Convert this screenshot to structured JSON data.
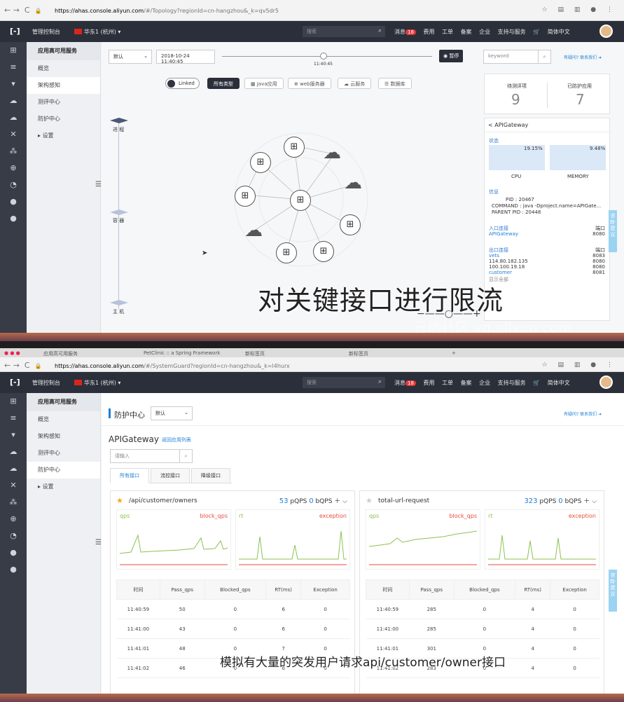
{
  "top": {
    "url_host": "https://ahas.console.aliyun.com",
    "url_path": "/#/Topology?regionId=cn-hangzhou&_k=qv5dr5",
    "console": "管理控制台",
    "region": "华东1 (杭州)",
    "search_placeholder": "搜索",
    "msg_label": "消息",
    "msg_count": "18",
    "menu": [
      "费用",
      "工单",
      "备案",
      "企业",
      "支持与服务"
    ],
    "lang": "简体中文",
    "sidebar_title": "应用高可用服务",
    "sidebar_items": [
      "概览",
      "架构感知",
      "测评中心",
      "防护中心",
      "设置"
    ],
    "env_select": "默认",
    "datetime": "2018-10-24 11:40:45",
    "slider_time": "11:40:45",
    "pause_label": "暂停",
    "keyword_placeholder": "keyword",
    "help_link": "有疑问? 联系我们",
    "linked_label": "Linked",
    "filters": [
      "所有类型",
      "Java应用",
      "web服务器",
      "云服务",
      "数据库"
    ],
    "layers": [
      "进 程",
      "容 器",
      "主 机"
    ],
    "score_labels": [
      "待测评项",
      "已防护应用"
    ],
    "score_values": [
      "9",
      "7"
    ],
    "detail_title": "APIGateway",
    "status_label": "状态",
    "cpu_pct": "19.15%",
    "mem_pct": "9.48%",
    "cpu_label": "CPU",
    "mem_label": "MEMORY",
    "info_label": "信息",
    "pid": "PID : 20467",
    "command": "COMMAND : java -Dproject.name=APIGate...",
    "ppid": "PARENT PID : 20448",
    "inbound_label": "入口连接",
    "port_label": "端口",
    "inbound_name": "APIGateway",
    "inbound_port": "8080",
    "outbound_label": "出口连接",
    "outbound_names": [
      "vets",
      "114.80.182.135",
      "100.100.19.18",
      "customer"
    ],
    "outbound_ports": [
      "8083",
      "8080",
      "8080",
      "8081"
    ],
    "show_all": "显示全部",
    "subtitle": "对关键接口进行限流",
    "watermark": "云栖社区 yq.aliyun.com",
    "feedback": "咨询·建议"
  },
  "bottom": {
    "url_host": "https://ahas.console.aliyun.com",
    "url_path": "/#/SystemGuard?regionId=cn-hangzhou&_k=l4hurx",
    "tabs": [
      "应用高可用服务",
      "PetClinic :: a Spring Framework",
      "新标签页",
      "新标签页"
    ],
    "page_title": "防护中心",
    "env_select": "默认",
    "app_name": "APIGateway",
    "back_link": "返回应用列表",
    "search_placeholder": "请输入",
    "iface_tabs": [
      "所有接口",
      "流控接口",
      "降级接口"
    ],
    "cards": [
      {
        "name": "/api/customer/owners",
        "pqps": "53",
        "bqps": "0",
        "starred": true,
        "rows": [
          [
            "11:40:59",
            "50",
            "0",
            "6",
            "0"
          ],
          [
            "11:41:00",
            "43",
            "0",
            "6",
            "0"
          ],
          [
            "11:41:01",
            "48",
            "0",
            "7",
            "0"
          ],
          [
            "11:41:02",
            "46",
            "0",
            "6",
            "0"
          ]
        ]
      },
      {
        "name": "total-url-request",
        "pqps": "323",
        "bqps": "0",
        "starred": false,
        "rows": [
          [
            "11:40:59",
            "285",
            "0",
            "4",
            "0"
          ],
          [
            "11:41:00",
            "285",
            "0",
            "4",
            "0"
          ],
          [
            "11:41:01",
            "301",
            "0",
            "4",
            "0"
          ],
          [
            "11:41:02",
            "283",
            "0",
            "4",
            "0"
          ]
        ]
      }
    ],
    "pqps_unit": "pQPS",
    "bqps_unit": "bQPS",
    "chart_labels": [
      "qps",
      "block_qps",
      "rt",
      "exception"
    ],
    "columns": [
      "时间",
      "Pass_qps",
      "Blocked_qps",
      "RT(ms)",
      "Exception"
    ],
    "subtitle": "模拟有大量的突发用户请求api/customer/owner接口",
    "watermark": "云栖社区 yq.aliyun.com"
  }
}
